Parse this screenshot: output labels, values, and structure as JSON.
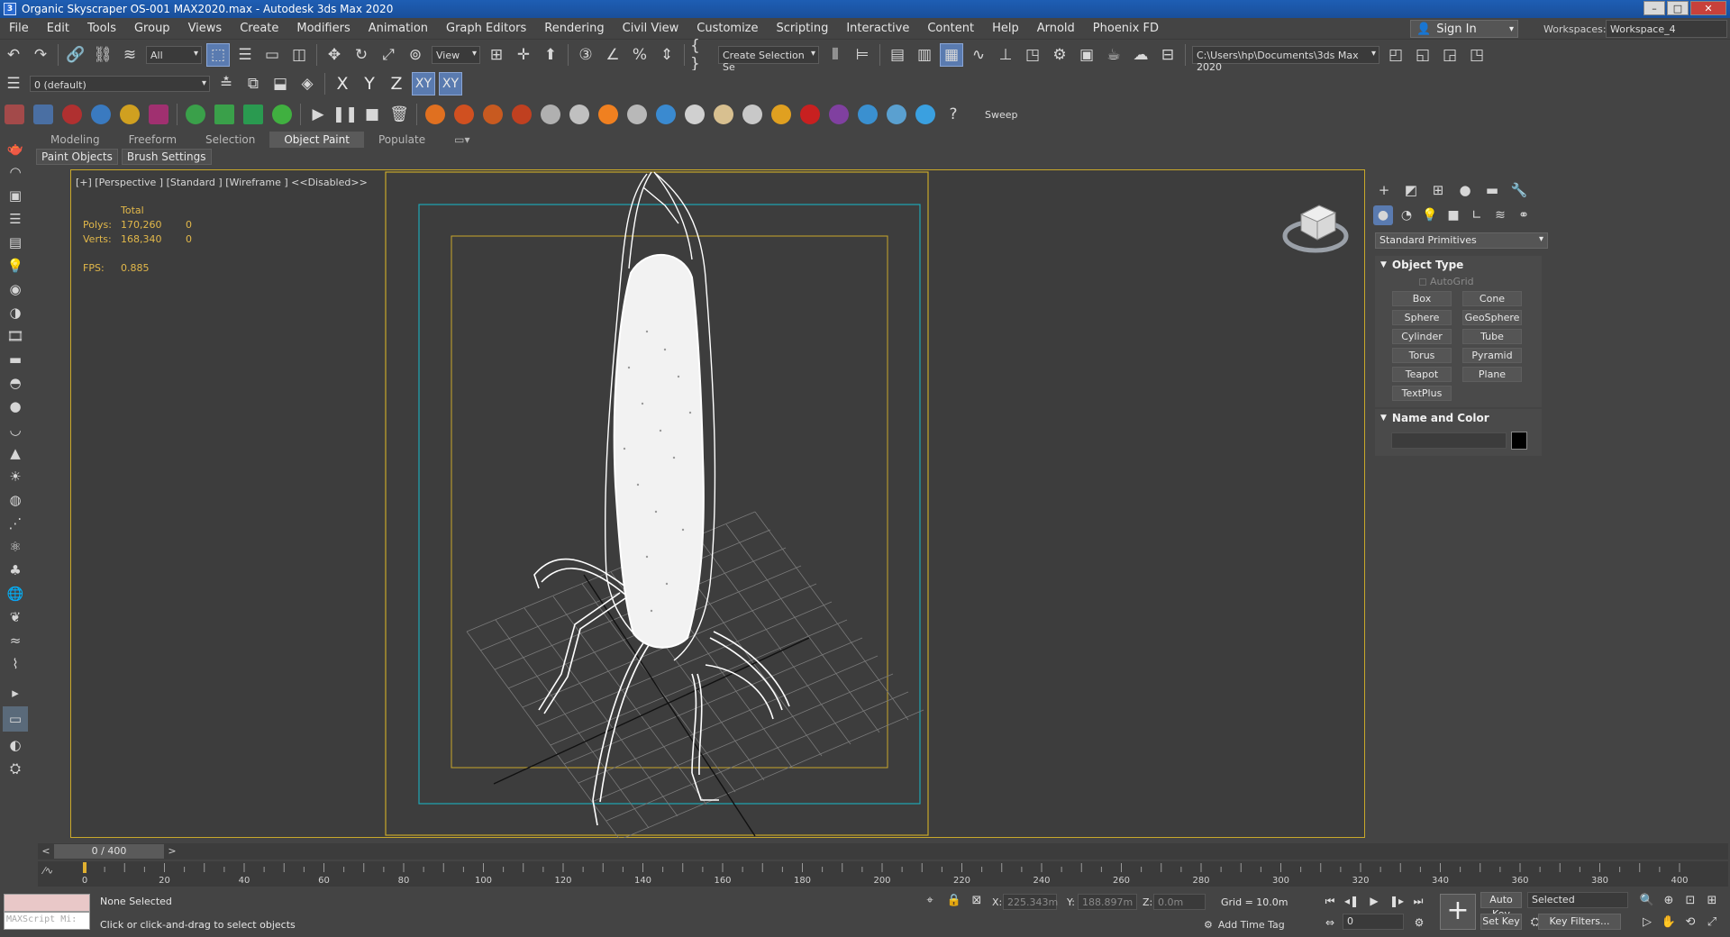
{
  "window": {
    "title": "Organic Skyscraper OS-001 MAX2020.max - Autodesk 3ds Max 2020",
    "app_icon_label": "3",
    "controls": [
      "–",
      "□",
      "✕"
    ]
  },
  "menu": [
    "File",
    "Edit",
    "Tools",
    "Group",
    "Views",
    "Create",
    "Modifiers",
    "Animation",
    "Graph Editors",
    "Rendering",
    "Civil View",
    "Customize",
    "Scripting",
    "Interactive",
    "Content",
    "Help",
    "Arnold",
    "Phoenix FD"
  ],
  "account": {
    "signin_label": "Sign In",
    "workspaces_label": "Workspaces:",
    "workspace_value": "Workspace_4"
  },
  "toolbar1": {
    "selection_filter": "All",
    "view_dropdown": "View",
    "selection_set": "Create Selection Se",
    "project_path": "C:\\Users\\hp\\Documents\\3ds Max 2020"
  },
  "toolbar2": {
    "layer_value": "0 (default)",
    "axes": [
      "X",
      "Y",
      "Z",
      "XY",
      "XY"
    ]
  },
  "toolbar3": {
    "sweep_label": "Sweep"
  },
  "ribbon": {
    "tabs": [
      "Modeling",
      "Freeform",
      "Selection",
      "Object Paint",
      "Populate"
    ],
    "active_tab": "Object Paint",
    "sub_buttons": [
      "Paint Objects",
      "Brush Settings"
    ]
  },
  "viewport": {
    "label": "[+] [Perspective ] [Standard ] [Wireframe ]  <<Disabled>>",
    "stats": {
      "header": "Total",
      "polys_label": "Polys:",
      "polys_value": "170,260",
      "polys_sel": "0",
      "verts_label": "Verts:",
      "verts_value": "168,340",
      "verts_sel": "0",
      "fps_label": "FPS:",
      "fps_value": "0.885"
    },
    "colors": {
      "safe_frame_outer": "#c9a82a",
      "safe_frame_action": "#1fa6b5",
      "safe_frame_title": "#c9a82a",
      "wireframe": "#ffffff",
      "grid": "#7a7a7a"
    }
  },
  "command_panel": {
    "dropdown": "Standard Primitives",
    "object_type": {
      "title": "Object Type",
      "autogrid": "AutoGrid",
      "buttons": [
        "Box",
        "Cone",
        "Sphere",
        "GeoSphere",
        "Cylinder",
        "Tube",
        "Torus",
        "Pyramid",
        "Teapot",
        "Plane",
        "TextPlus"
      ]
    },
    "name_and_color": {
      "title": "Name and Color",
      "name_value": "",
      "color": "#000000"
    }
  },
  "timeline": {
    "frame_indicator": "0 / 400",
    "prev": "<",
    "next": ">",
    "ruler_ticks": [
      "0",
      "20",
      "40",
      "60",
      "80",
      "100",
      "120",
      "140",
      "160",
      "180",
      "200",
      "220",
      "240",
      "260",
      "280",
      "300",
      "320",
      "340",
      "360",
      "380",
      "400"
    ],
    "total_frames": 400
  },
  "status": {
    "maxscript_placeholder": "MAXScript Mi:",
    "selection": "None Selected",
    "prompt": "Click or click-and-drag to select objects",
    "x_label": "X:",
    "x_value": "225.343m",
    "y_label": "Y:",
    "y_value": "188.897m",
    "z_label": "Z:",
    "z_value": "0.0m",
    "grid": "Grid = 10.0m",
    "add_time_tag": "Add Time Tag",
    "current_frame": "0",
    "auto_key": "Auto Key",
    "set_key": "Set Key",
    "key_mode": "Selected",
    "key_filters": "Key Filters..."
  }
}
